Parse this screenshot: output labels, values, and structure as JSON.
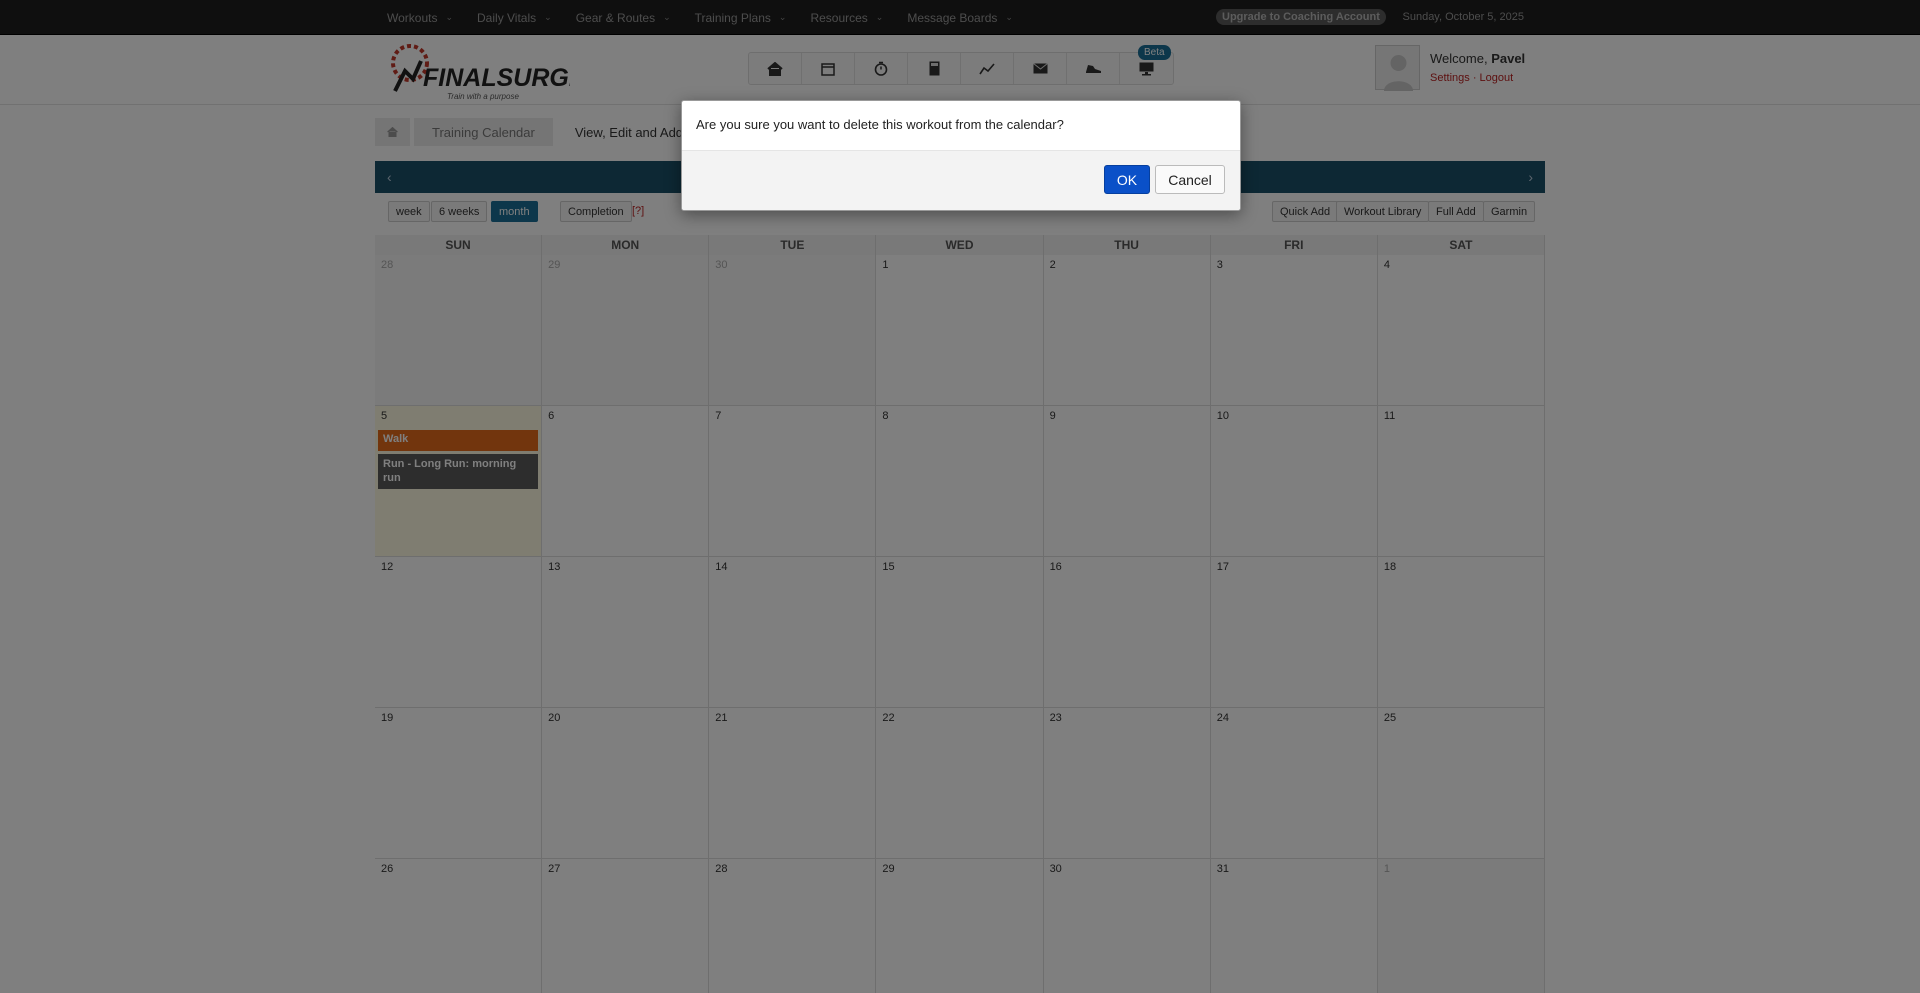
{
  "topnav": {
    "items": [
      {
        "label": "Workouts"
      },
      {
        "label": "Daily Vitals"
      },
      {
        "label": "Gear & Routes"
      },
      {
        "label": "Training Plans"
      },
      {
        "label": "Resources"
      },
      {
        "label": "Message Boards"
      }
    ],
    "upgrade_label": "Upgrade to Coaching Account",
    "date": "Sunday, October 5, 2025"
  },
  "header": {
    "logo_text": "FINALSURGE",
    "logo_tagline": "Train with a purpose",
    "icons": [
      "home-icon",
      "calendar-icon",
      "stopwatch-icon",
      "calculator-icon",
      "chart-icon",
      "mail-icon",
      "shoe-icon",
      "monitor-icon"
    ],
    "beta_label": "Beta",
    "welcome_prefix": "Welcome,",
    "user_name": "Pavel",
    "settings_label": "Settings",
    "separator": "·",
    "logout_label": "Logout"
  },
  "breadcrumb": {
    "item1": "Training Calendar",
    "item2": "View, Edit and Add"
  },
  "toolbar": {
    "week": "week",
    "six_weeks": "6 weeks",
    "month": "month",
    "completion": "Completion",
    "help": "[?]",
    "quick_add": "Quick Add",
    "workout_library": "Workout Library",
    "full_add": "Full Add",
    "garmin": "Garmin"
  },
  "calendar": {
    "dow": [
      "SUN",
      "MON",
      "TUE",
      "WED",
      "THU",
      "FRI",
      "SAT"
    ],
    "weeks": [
      [
        "28",
        "29",
        "30",
        "1",
        "2",
        "3",
        "4"
      ],
      [
        "5",
        "6",
        "7",
        "8",
        "9",
        "10",
        "11"
      ],
      [
        "12",
        "13",
        "14",
        "15",
        "16",
        "17",
        "18"
      ],
      [
        "19",
        "20",
        "21",
        "22",
        "23",
        "24",
        "25"
      ],
      [
        "26",
        "27",
        "28",
        "29",
        "30",
        "31",
        "1"
      ]
    ],
    "workouts": {
      "walk": "Walk",
      "run": "Run - Long Run: morning run"
    }
  },
  "dialog": {
    "message": "Are you sure you want to delete this workout from the calendar?",
    "ok": "OK",
    "cancel": "Cancel"
  }
}
